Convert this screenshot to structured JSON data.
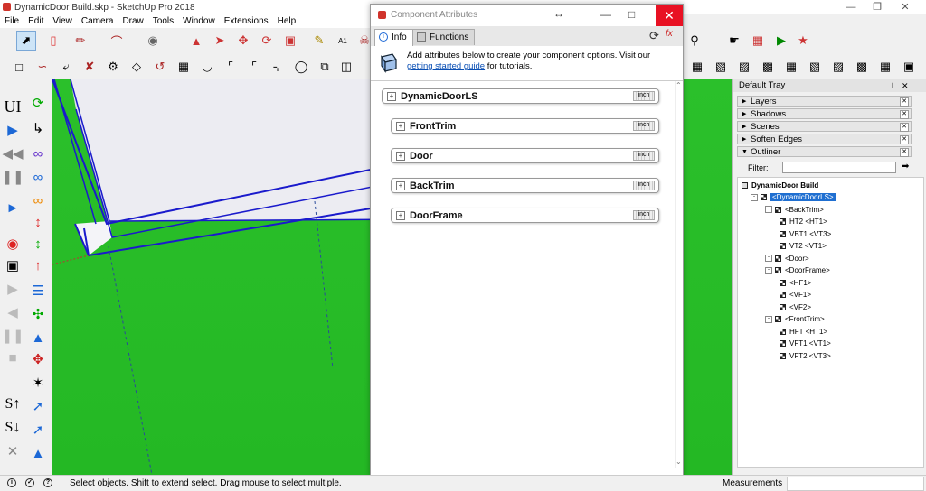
{
  "window": {
    "title": "DynamicDoor Build.skp - SketchUp Pro 2018"
  },
  "menu": {
    "items": [
      "File",
      "Edit",
      "View",
      "Camera",
      "Draw",
      "Tools",
      "Window",
      "Extensions",
      "Help"
    ]
  },
  "left_toolbar": {
    "ui_label": "UI"
  },
  "dialog": {
    "title": "Component Attributes",
    "tabs": [
      {
        "label": "Info"
      },
      {
        "label": "Functions"
      }
    ],
    "info_text_prefix": "Add attributes below to create your component options. Visit our ",
    "info_link": "getting started guide",
    "info_text_suffix": " for tutorials.",
    "unit_label": "inch",
    "components": [
      {
        "name": "DynamicDoorLS"
      },
      {
        "name": "FrontTrim"
      },
      {
        "name": "Door"
      },
      {
        "name": "BackTrim"
      },
      {
        "name": "DoorFrame"
      }
    ]
  },
  "tray": {
    "title": "Default Tray",
    "panels": [
      {
        "label": "Layers",
        "expanded": false
      },
      {
        "label": "Shadows",
        "expanded": false
      },
      {
        "label": "Scenes",
        "expanded": false
      },
      {
        "label": "Soften Edges",
        "expanded": false
      },
      {
        "label": "Outliner",
        "expanded": true
      }
    ],
    "filter_label": "Filter:",
    "filter_value": "",
    "outliner": {
      "root": "DynamicDoor Build",
      "nodes": [
        {
          "label": "<DynamicDoorLS>",
          "level": 1,
          "selected": true
        },
        {
          "label": "<BackTrim>",
          "level": 2
        },
        {
          "label": "HT2 <HT1>",
          "level": 3
        },
        {
          "label": "VBT1 <VT3>",
          "level": 3
        },
        {
          "label": "VT2 <VT1>",
          "level": 3
        },
        {
          "label": "<Door>",
          "level": 2
        },
        {
          "label": "<DoorFrame>",
          "level": 2
        },
        {
          "label": "<HF1>",
          "level": 3
        },
        {
          "label": "<VF1>",
          "level": 3
        },
        {
          "label": "<VF2>",
          "level": 3
        },
        {
          "label": "<FrontTrim>",
          "level": 2
        },
        {
          "label": "HFT <HT1>",
          "level": 3
        },
        {
          "label": "VFT1 <VT1>",
          "level": 3
        },
        {
          "label": "VFT2 <VT3>",
          "level": 3
        }
      ]
    }
  },
  "status": {
    "message": "Select objects. Shift to extend select. Drag mouse to select multiple.",
    "measurements_label": "Measurements",
    "measurements_value": ""
  },
  "colors": {
    "canvas": "#24b824",
    "accent": "#1f6fd1",
    "close": "#e81123",
    "edge": "#0000cc"
  }
}
